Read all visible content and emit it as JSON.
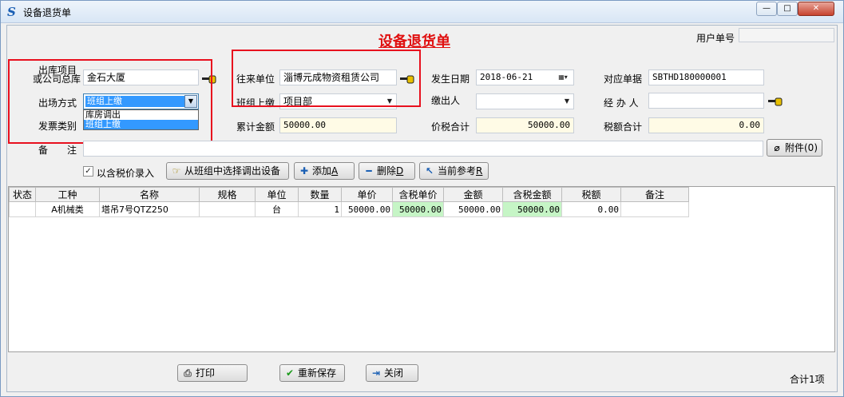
{
  "window": {
    "title": "设备退货单",
    "min": "—",
    "max": "□",
    "close": "✕"
  },
  "header": {
    "doc_title": "设备退货单",
    "user_no_label": "用户单号",
    "user_no_value": ""
  },
  "form": {
    "source_label_line1": "出库项目",
    "source_label_line2": "或公司总库",
    "source_value": "金石大厦",
    "exit_mode_label": "出场方式",
    "exit_mode_value": "班组上缴",
    "exit_mode_options": [
      "库房调出",
      "班组上缴"
    ],
    "invoice_type_label": "发票类别",
    "partner_label": "往来单位",
    "partner_value": "淄博元成物资租赁公司",
    "team_label": "班组上缴",
    "team_value": "项目部",
    "total_label": "累计金额",
    "total_value": "50000.00",
    "date_label": "发生日期",
    "date_value": "2018-06-21",
    "payer_label": "缴出人",
    "payer_value": "",
    "tax_total_label": "价税合计",
    "tax_total_value": "50000.00",
    "ref_no_label": "对应单据",
    "ref_no_value": "SBTHD180000001",
    "handler_label": "经 办 人",
    "handler_value": "",
    "tax_amount_label": "税额合计",
    "tax_amount_value": "0.00",
    "remark_label": "备　　注",
    "remark_value": "",
    "attach_label": "附件(0)"
  },
  "toolbar": {
    "tax_checkbox_label": "以含税价录入",
    "tax_checkbox_checked": true,
    "select_from_team": "从班组中选择调出设备",
    "add": "添加",
    "add_key": "A",
    "delete": "删除",
    "delete_key": "D",
    "reference": "当前参考",
    "reference_key": "R"
  },
  "grid": {
    "columns": [
      "状态",
      "工种",
      "名称",
      "规格",
      "单位",
      "数量",
      "单价",
      "含税单价",
      "金额",
      "含税金额",
      "税额",
      "备注"
    ],
    "rows": [
      {
        "status": "",
        "type": "A机械类",
        "name": "塔吊7号QTZ250",
        "spec": "",
        "unit": "台",
        "qty": "1",
        "price": "50000.00",
        "tax_price": "50000.00",
        "amount": "50000.00",
        "tax_amount": "50000.00",
        "tax": "0.00",
        "remark": ""
      }
    ]
  },
  "footer": {
    "print": "打印",
    "resave": "重新保存",
    "close": "关闭",
    "total": "合计1项"
  },
  "colors": {
    "title_red": "#e01010",
    "highlight_box": "#e8101e",
    "green_cell": "#c6f5c6",
    "yellow_field": "#fffbe6",
    "selection_blue": "#3399ff"
  }
}
